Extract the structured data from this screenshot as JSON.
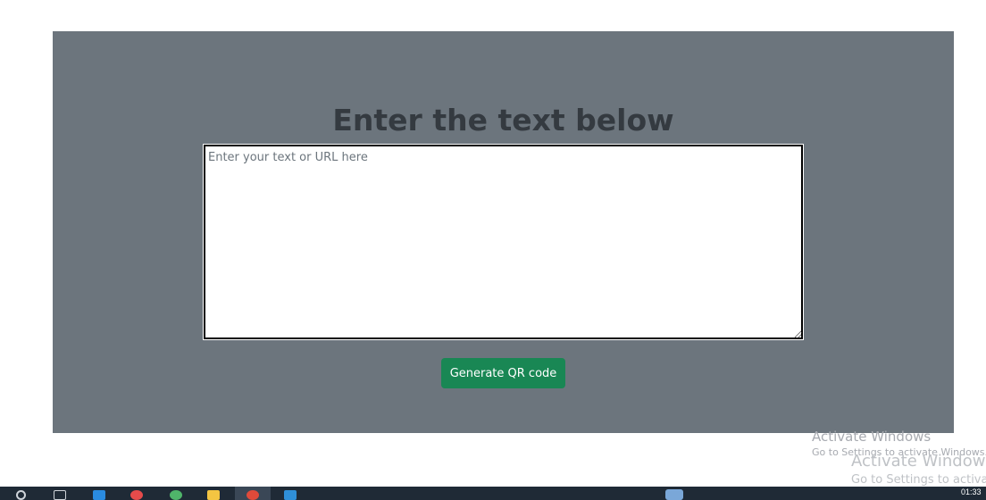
{
  "main": {
    "heading": "Enter the text below",
    "textarea_placeholder": "Enter your text or URL here",
    "generate_button_label": "Generate QR code"
  },
  "watermark": {
    "title": "Activate Windows",
    "subtitle": "Go to Settings to activate Windows.",
    "title_2": "Activate Windows",
    "subtitle_2": "Go to Settings to activate"
  },
  "taskbar": {
    "clock": "01:33",
    "icons": [
      "search-icon",
      "task-view-icon",
      "store-icon",
      "app-icon",
      "app-icon",
      "file-explorer-icon",
      "chrome-icon",
      "vscode-icon"
    ]
  },
  "colors": {
    "panel_bg": "#6c757d",
    "heading": "#343a40",
    "button_bg": "#198754",
    "taskbar_bg": "#1f2a36"
  }
}
